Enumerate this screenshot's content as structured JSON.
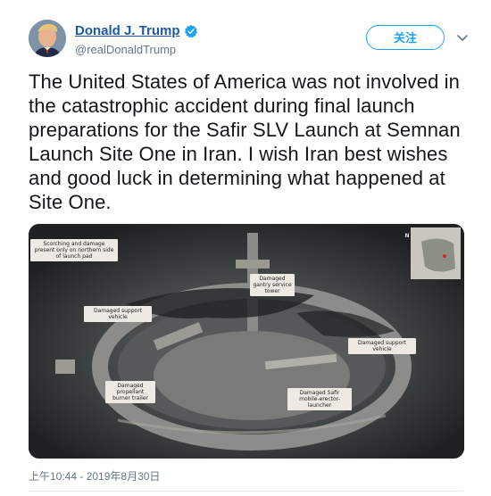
{
  "author": {
    "display_name": "Donald J. Trump",
    "handle": "@realDonaldTrump",
    "verified": true
  },
  "actions": {
    "follow_label": "关注",
    "more_icon": "chevron-down-icon"
  },
  "tweet": {
    "text": "The United States of America was not involved in the catastrophic accident during final launch preparations for the Safir SLV Launch at Semnan Launch Site One in Iran. I wish Iran best wishes and good luck in determining what happened at Site One.",
    "timestamp": "上午10:44 - 2019年8月30日"
  },
  "media": {
    "callouts": {
      "scorching": "Scorching and damage present only on northern side of launch pad",
      "gantry": "Damaged gantry service tower",
      "support_left": "Damaged support vehicle",
      "support_right": "Damaged support vehicle",
      "propellant": "Damaged propellant burner trailer",
      "safir": "Damaged Safir mobile-erector-launcher"
    },
    "north_marker": "N"
  },
  "colors": {
    "link": "#1b5aa8",
    "accent": "#1da1f2",
    "muted": "#657786",
    "text": "#14171a"
  }
}
